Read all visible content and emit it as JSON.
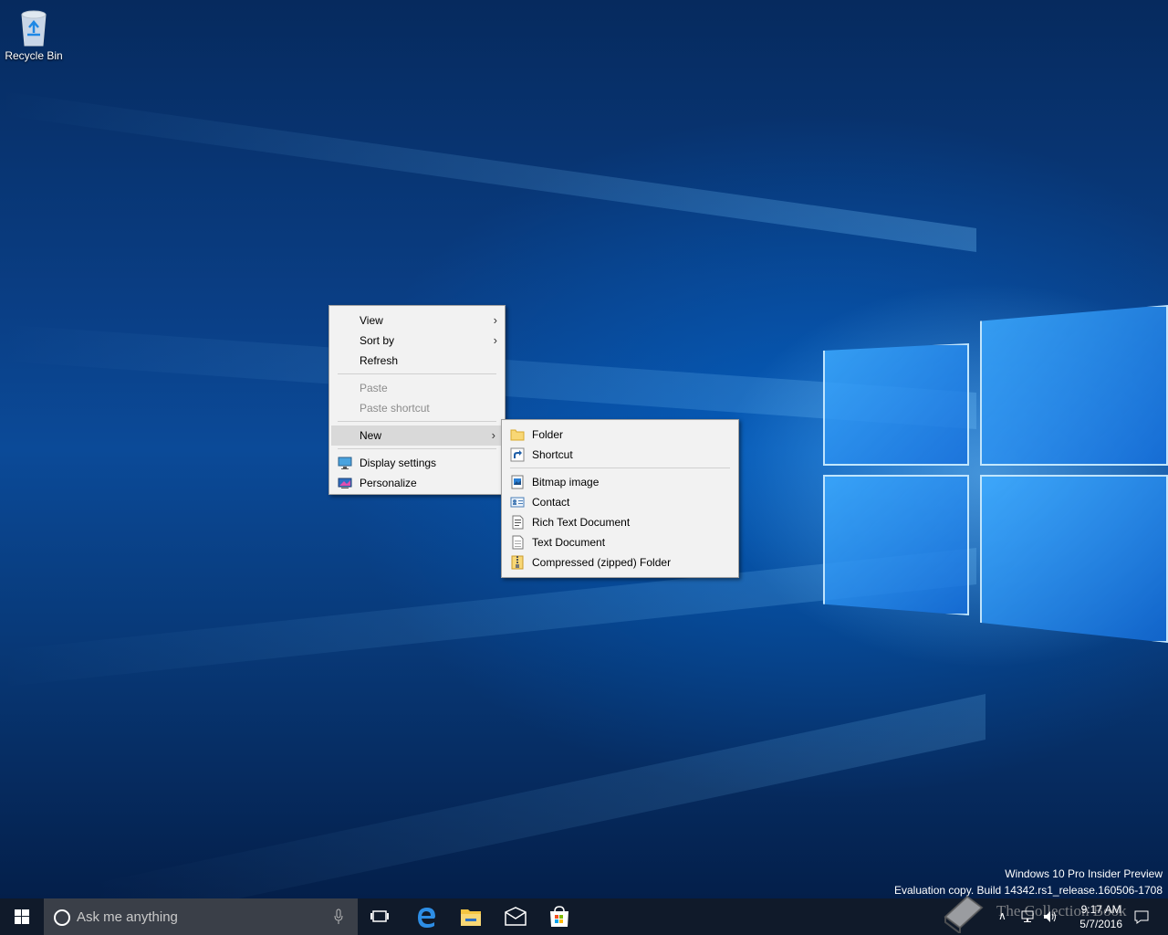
{
  "desktop": {
    "recycle_bin_label": "Recycle Bin"
  },
  "context_menu": {
    "items": [
      {
        "label": "View",
        "has_submenu": true,
        "enabled": true
      },
      {
        "label": "Sort by",
        "has_submenu": true,
        "enabled": true
      },
      {
        "label": "Refresh",
        "has_submenu": false,
        "enabled": true
      },
      {
        "label": "Paste",
        "has_submenu": false,
        "enabled": false
      },
      {
        "label": "Paste shortcut",
        "has_submenu": false,
        "enabled": false
      },
      {
        "label": "New",
        "has_submenu": true,
        "enabled": true,
        "highlighted": true
      },
      {
        "label": "Display settings",
        "icon": "display-icon",
        "enabled": true
      },
      {
        "label": "Personalize",
        "icon": "personalize-icon",
        "enabled": true
      }
    ]
  },
  "new_submenu": {
    "items": [
      {
        "label": "Folder",
        "icon": "folder-icon"
      },
      {
        "label": "Shortcut",
        "icon": "shortcut-icon"
      },
      {
        "label": "Bitmap image",
        "icon": "bitmap-icon"
      },
      {
        "label": "Contact",
        "icon": "contact-icon"
      },
      {
        "label": "Rich Text Document",
        "icon": "rich-text-icon"
      },
      {
        "label": "Text Document",
        "icon": "text-document-icon"
      },
      {
        "label": "Compressed (zipped) Folder",
        "icon": "zip-folder-icon"
      }
    ]
  },
  "watermark": {
    "line1": "Windows 10 Pro Insider Preview",
    "line2": "Evaluation copy. Build 14342.rs1_release.160506-1708"
  },
  "taskbar": {
    "search_placeholder": "Ask me anything",
    "clock_time": "9:17 AM",
    "clock_date": "5/7/2016",
    "overlay_logo_text": "The Collection Book"
  },
  "colors": {
    "accent": "#0078d7",
    "taskbar": "#101a2a",
    "menu_bg": "#f2f2f2"
  }
}
